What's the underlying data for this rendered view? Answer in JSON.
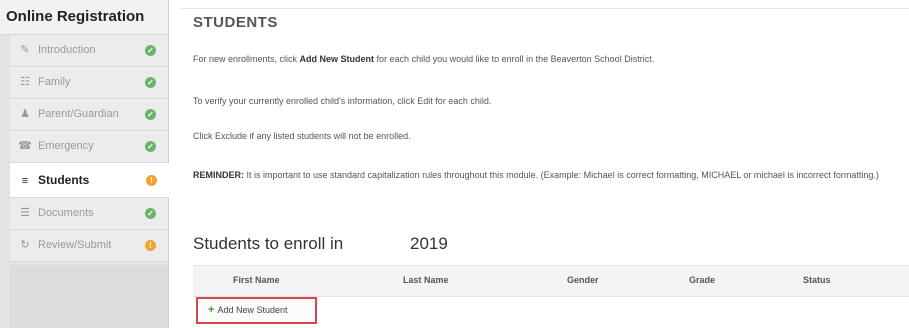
{
  "sidebar": {
    "title": "Online Registration",
    "items": [
      {
        "label": "Introduction",
        "icon": "✎",
        "status": "✓",
        "status_type": "ok"
      },
      {
        "label": "Family",
        "icon": "☷",
        "status": "✓",
        "status_type": "ok"
      },
      {
        "label": "Parent/Guardian",
        "icon": "♟",
        "status": "✓",
        "status_type": "ok"
      },
      {
        "label": "Emergency",
        "icon": "☎",
        "status": "✓",
        "status_type": "ok"
      },
      {
        "label": "Students",
        "icon": "≡",
        "status": "!",
        "status_type": "warn"
      },
      {
        "label": "Documents",
        "icon": "☰",
        "status": "✓",
        "status_type": "ok"
      },
      {
        "label": "Review/Submit",
        "icon": "↻",
        "status": "!",
        "status_type": "warn"
      }
    ]
  },
  "main": {
    "title": "STUDENTS",
    "p1_pre": "For new enrollments, click ",
    "p1_bold": "Add New Student",
    "p1_post": " for each child you would like to enroll in the Beaverton School District.",
    "p2": "To verify your currently enrolled child's information, click Edit for each child.",
    "p3": "Click Exclude if any listed students will not be enrolled.",
    "p4_bold": "REMINDER:",
    "p4_post": " It is important to use standard capitalization rules throughout this module. (Example: Michael is correct formatting, MICHAEL or michael is incorrect formatting.)",
    "enroll_heading": "Students to enroll in",
    "enroll_year": "2019",
    "table_headers": {
      "first": "First Name",
      "last": "Last Name",
      "gender": "Gender",
      "grade": "Grade",
      "status": "Status"
    },
    "add_button": "Add New Student",
    "add_icon": "+"
  },
  "colors": {
    "ok": "#6cb36a",
    "warn": "#f0a233",
    "highlight": "#d9454a",
    "add_icon": "#3d9a3a"
  }
}
